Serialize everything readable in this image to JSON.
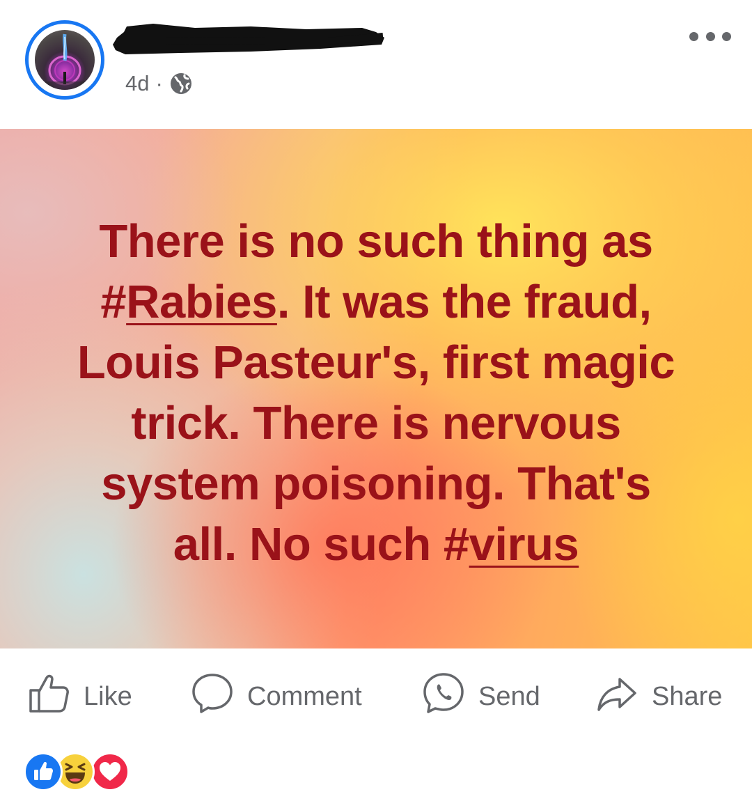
{
  "post": {
    "author": {
      "name_redacted": true,
      "avatar": "avatar-image"
    },
    "timestamp": "4d",
    "separator": "·",
    "audience_icon": "globe-icon",
    "more_icon": "more-options-icon",
    "background_text": {
      "lines": [
        {
          "before": "There is no such thing as",
          "tag_hash": "",
          "tag_word": "",
          "after": ""
        },
        {
          "before": "",
          "tag_hash": "#",
          "tag_word": "Rabies",
          "after": ". It was the fraud,"
        },
        {
          "before": "Louis Pasteur's, first magic",
          "tag_hash": "",
          "tag_word": "",
          "after": ""
        },
        {
          "before": "trick. There is nervous",
          "tag_hash": "",
          "tag_word": "",
          "after": ""
        },
        {
          "before": "system poisoning. That's",
          "tag_hash": "",
          "tag_word": "",
          "after": ""
        },
        {
          "before": "all. No such ",
          "tag_hash": "#",
          "tag_word": "virus",
          "after": ""
        }
      ],
      "text_color": "#9a1219"
    }
  },
  "actions": {
    "like": {
      "label": "Like",
      "icon": "thumbs-up-icon"
    },
    "comment": {
      "label": "Comment",
      "icon": "comment-bubble-icon"
    },
    "send": {
      "label": "Send",
      "icon": "messenger-icon"
    },
    "share": {
      "label": "Share",
      "icon": "share-arrow-icon"
    }
  },
  "reactions": [
    {
      "type": "like",
      "icon": "like-reaction-icon",
      "color": "#1877f2"
    },
    {
      "type": "haha",
      "icon": "haha-reaction-icon",
      "color": "#f7d13c"
    },
    {
      "type": "love",
      "icon": "love-reaction-icon",
      "color": "#f02849"
    }
  ],
  "colors": {
    "accent": "#1877f2",
    "secondary_text": "#65676b"
  }
}
